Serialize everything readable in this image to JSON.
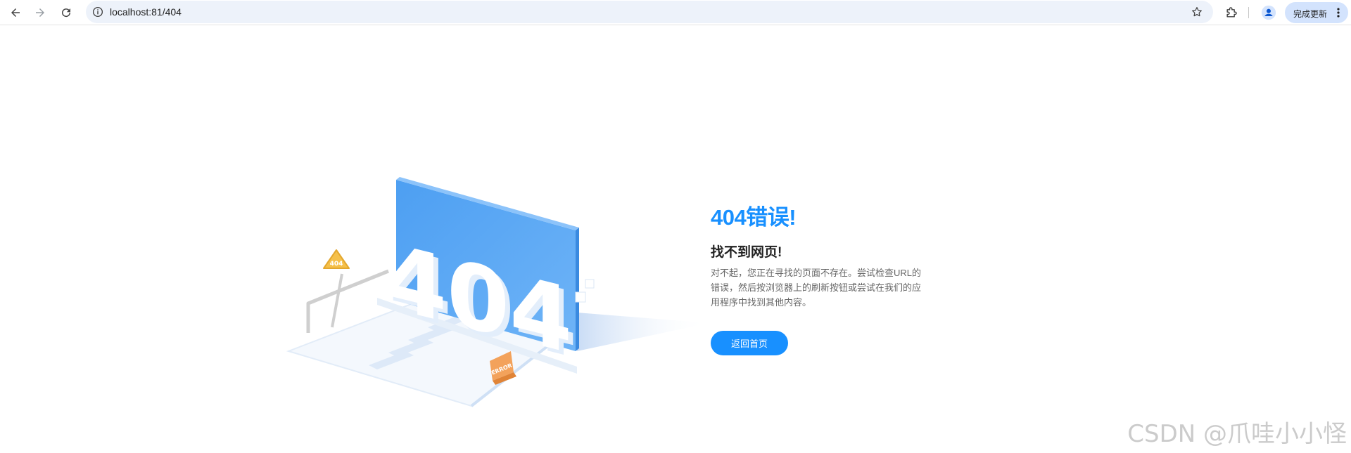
{
  "browser": {
    "url": "localhost:81/404",
    "update_label": "完成更新",
    "icons": {
      "back": "arrow-left-icon",
      "forward": "arrow-right-icon",
      "reload": "reload-icon",
      "site_info": "info-icon",
      "bookmark": "star-icon",
      "extensions": "puzzle-icon",
      "profile": "person-icon",
      "menu": "vertical-dots-icon"
    }
  },
  "page": {
    "title": "404错误!",
    "subtitle": "找不到网页!",
    "description": "对不起，您正在寻找的页面不存在。尝试检查URL的错误，然后按浏览器上的刷新按钮或尝试在我们的应用程序中找到其他内容。",
    "home_button": "返回首页",
    "illustration": {
      "big_text": "404",
      "sign_text": "404",
      "card_text": "ERROR"
    }
  },
  "watermark": "CSDN @爪哇小小怪",
  "colors": {
    "accent": "#1890ff",
    "panel_blue": "#5aa8f5",
    "sign_yellow": "#f5c04a",
    "card_orange": "#f3a25b"
  }
}
